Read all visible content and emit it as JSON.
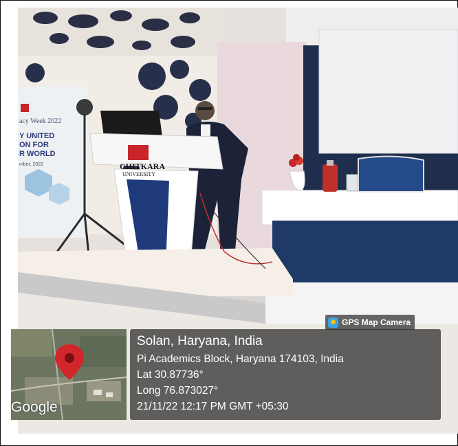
{
  "photo": {
    "banner_lines": [
      "acy Week 2022",
      "Y UNITED",
      "ON FOR",
      "R WORLD",
      "mber, 2022"
    ],
    "podium_brand": "CHITKARA",
    "podium_sub": "UNIVERSITY"
  },
  "camera_badge": {
    "label": "GPS Map Camera"
  },
  "map": {
    "logo_text": "Google"
  },
  "location": {
    "city_line": "Solan, Haryana, India",
    "address_line": "Pi Academics Block, Haryana 174103, India",
    "lat_line": "Lat 30.87736°",
    "long_line": "Long 76.873027°",
    "datetime_line": "21/11/22 12:17 PM GMT +05:30"
  },
  "colors": {
    "podium_blue": "#1f3a7a",
    "marker_red": "#d2262b",
    "bottle_red": "#c0302b"
  }
}
